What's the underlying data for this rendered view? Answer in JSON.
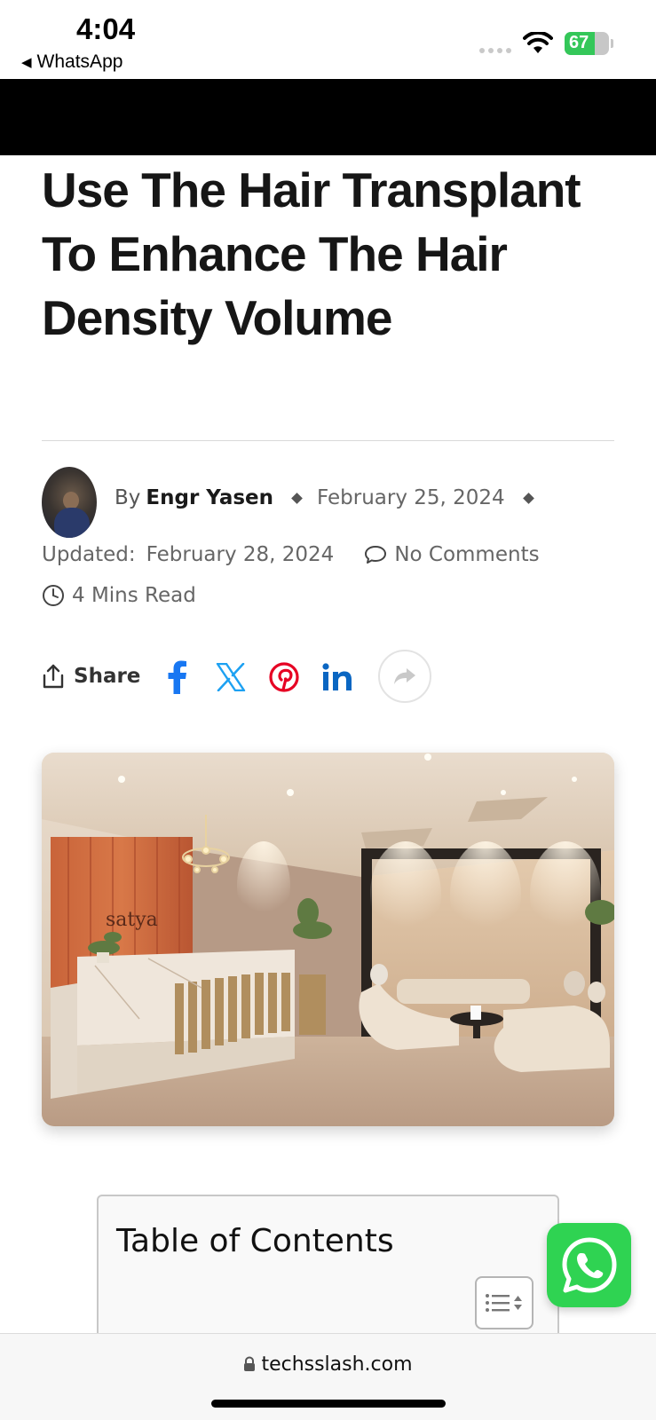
{
  "status_bar": {
    "time": "4:04",
    "back_app": "WhatsApp",
    "battery_level": "67",
    "battery_fraction": 0.67
  },
  "article": {
    "title": "Use The Hair Transplant To Enhance The Hair Density Volume",
    "by_label": "By",
    "author": "Engr Yasen",
    "published_date": "February 25, 2024",
    "updated_label": "Updated:",
    "updated_date": "February 28, 2024",
    "comments": "No Comments",
    "read_time": "4 Mins Read"
  },
  "share": {
    "label": "Share",
    "icons": [
      "facebook-icon",
      "x-icon",
      "pinterest-icon",
      "linkedin-icon",
      "share-more-icon"
    ]
  },
  "hero_image": {
    "brand_text": "satya"
  },
  "toc": {
    "title": "Table of Contents"
  },
  "browser": {
    "url": "techsslash.com"
  },
  "colors": {
    "facebook": "#1877f2",
    "x": "#1da1f2",
    "pinterest": "#e60023",
    "linkedin": "#0a66c2",
    "whatsapp": "#2fd352",
    "battery": "#34c759"
  }
}
